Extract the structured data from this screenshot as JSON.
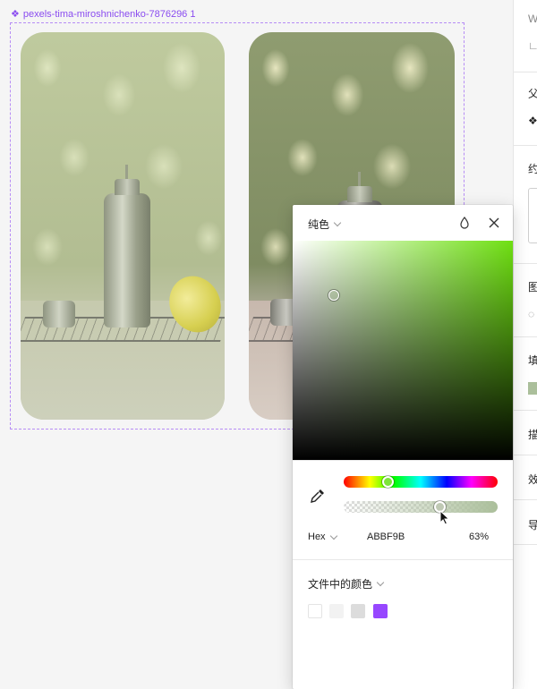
{
  "canvas": {
    "frame_label": "pexels-tima-miroshnichenko-7876296 1"
  },
  "panel": {
    "items": [
      "W",
      "父",
      "约",
      "图",
      "填",
      "描",
      "效",
      "导"
    ]
  },
  "picker": {
    "mode_label": "纯色",
    "format_label": "Hex",
    "hex_value": "ABBF9B",
    "opacity": "63%",
    "hue_position": 0.27,
    "alpha_fraction": 0.63,
    "doc_colors_label": "文件中的颜色",
    "doc_colors": [
      "#ffffff",
      "#f2f2f2",
      "#dcdcdc",
      "#9747ff"
    ],
    "accent": "#abbf9b"
  }
}
